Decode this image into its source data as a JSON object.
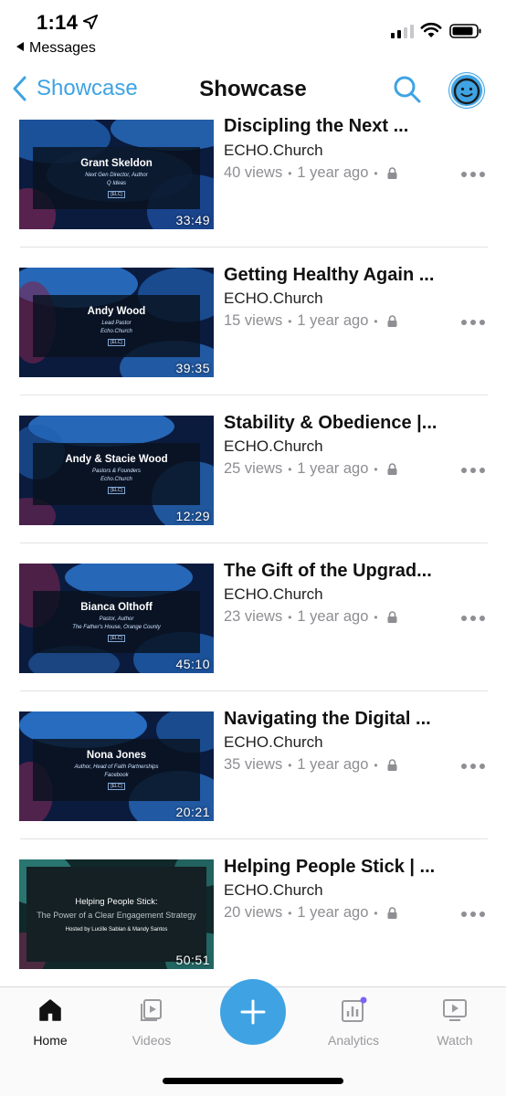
{
  "status_bar": {
    "time": "1:14",
    "back_app": "Messages"
  },
  "nav": {
    "back_label": "Showcase",
    "title": "Showcase"
  },
  "colors": {
    "accent": "#3fa3e3",
    "meta_text": "#8e8e93"
  },
  "videos": [
    {
      "title": "Discipling the Next ...",
      "channel": "ECHO.Church",
      "views": "40 views",
      "age": "1 year ago",
      "duration": "33:49",
      "thumb_name": "Grant Skeldon",
      "thumb_sub1": "Next Gen Director, Author",
      "thumb_sub2": "Q Ideas",
      "thumb_tag": "[ELC]"
    },
    {
      "title": "Getting Healthy Again ...",
      "channel": "ECHO.Church",
      "views": "15 views",
      "age": "1 year ago",
      "duration": "39:35",
      "thumb_name": "Andy Wood",
      "thumb_sub1": "Lead Pastor",
      "thumb_sub2": "Echo.Church",
      "thumb_tag": "[ELC]"
    },
    {
      "title": "Stability & Obedience |...",
      "channel": "ECHO.Church",
      "views": "25 views",
      "age": "1 year ago",
      "duration": "12:29",
      "thumb_name": "Andy & Stacie Wood",
      "thumb_sub1": "Pastors & Founders",
      "thumb_sub2": "Echo.Church",
      "thumb_tag": "[ELC]"
    },
    {
      "title": "The Gift of the Upgrad...",
      "channel": "ECHO.Church",
      "views": "23 views",
      "age": "1 year ago",
      "duration": "45:10",
      "thumb_name": "Bianca Olthoff",
      "thumb_sub1": "Pastor, Author",
      "thumb_sub2": "The Father's House, Orange County",
      "thumb_tag": "[ELC]"
    },
    {
      "title": "Navigating the Digital ...",
      "channel": "ECHO.Church",
      "views": "35 views",
      "age": "1 year ago",
      "duration": "20:21",
      "thumb_name": "Nona Jones",
      "thumb_sub1": "Author, Head of Faith Partnerships",
      "thumb_sub2": "Facebook",
      "thumb_tag": "[ELC]"
    },
    {
      "title": "Helping People Stick | ...",
      "channel": "ECHO.Church",
      "views": "20 views",
      "age": "1 year ago",
      "duration": "50:51",
      "thumb_title": "Helping People Stick:",
      "thumb_subtitle": "The Power of a Clear Engagement Strategy",
      "thumb_hosts": "Hosted by Lucille Sablan & Mandy Santos"
    }
  ],
  "tabs": {
    "home": "Home",
    "videos": "Videos",
    "analytics": "Analytics",
    "watch": "Watch"
  }
}
